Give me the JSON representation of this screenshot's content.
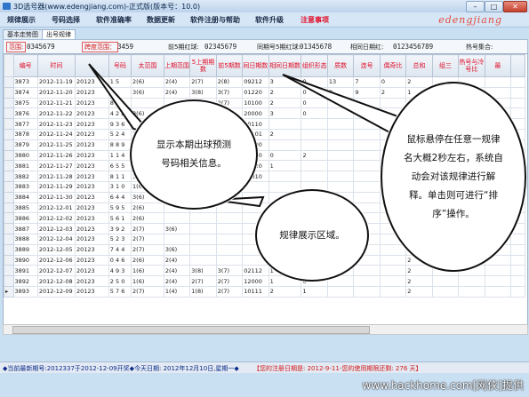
{
  "window": {
    "title": "3D选号器(www.edengjiang.com)-正式版(版本号：10.0)"
  },
  "menu": [
    "规律展示",
    "号码选择",
    "软件准确率",
    "数据更新",
    "软件注册与帮助",
    "软件升级",
    "注意事项"
  ],
  "menu_accent": "#e0102a",
  "logo": "edengjiang",
  "tabs": [
    "基本走势图",
    "出号规律"
  ],
  "infobar": {
    "range_label": "范围:",
    "range_value": "0345679",
    "span_label": "跨度范围：",
    "span_value": "3459",
    "prev5_label": "前5期红球:",
    "prev5_value": "02345679",
    "same5_label": "同期号5期红球:",
    "same5_value": "01345678",
    "adjacent_label": "相同日期红:",
    "adjacent_value": "0123456789",
    "hot_label": "热号集合:",
    "hot_value": ""
  },
  "table": {
    "headers": [
      "编号",
      "时间",
      "",
      "号码",
      "太范围",
      "上期范围",
      "5上期期数",
      "前5期数",
      "同日期数",
      "相同日期数",
      "组织形态",
      "质数",
      "连号",
      "偶奇比",
      "总和",
      "组三",
      "热号与冷号比",
      "最",
      ""
    ],
    "rows": [
      [
        "3873",
        "2012-11-19",
        "20123",
        "1 5",
        "2(6)",
        "2(4)",
        "2(7)",
        "2(8)",
        "09212",
        "3",
        "0",
        "13",
        "7",
        "0",
        "2"
      ],
      [
        "3874",
        "2012-11-20",
        "20123",
        "",
        "3(6)",
        "2(4)",
        "3(8)",
        "3(7)",
        "01220",
        "2",
        "0",
        "2",
        "9",
        "2",
        "1"
      ],
      [
        "3875",
        "2012-11-21",
        "20123",
        "8 5",
        "",
        "",
        "2(7)",
        "2(7)",
        "10100",
        "2",
        "0",
        "",
        "",
        "",
        "2"
      ],
      [
        "3876",
        "2012-11-22",
        "20123",
        "4 2 8",
        "3(6)",
        "",
        "3(8)",
        "3(7)",
        "20000",
        "3",
        "0",
        "",
        "",
        "",
        "2"
      ],
      [
        "3877",
        "2012-11-23",
        "20123",
        "9 3 6",
        "2(6)",
        "",
        "2(7)",
        "",
        "20110",
        "",
        "",
        "",
        "",
        "",
        "2"
      ],
      [
        "3878",
        "2012-11-24",
        "20123",
        "5 2 4",
        "2(6)",
        "",
        "2(8)",
        "",
        "02101",
        "2",
        "",
        "",
        "",
        "",
        "2"
      ],
      [
        "3879",
        "2012-11-25",
        "20123",
        "8 8 9",
        "2(6)",
        "",
        "2(7)",
        "",
        "01100",
        "",
        "",
        "",
        "",
        "",
        "2"
      ],
      [
        "3880",
        "2012-11-26",
        "20123",
        "1 1 4",
        "2(6)",
        "",
        "2(7)",
        "",
        "01220",
        "0",
        "2",
        "",
        "",
        "",
        "2"
      ],
      [
        "3881",
        "2012-11-27",
        "20123",
        "6 5 5",
        "2(6)",
        "",
        "2(8)",
        "",
        "00120",
        "1",
        "",
        "",
        "",
        "",
        "2"
      ],
      [
        "3882",
        "2012-11-28",
        "20123",
        "8 1 1",
        "3(6)",
        "",
        "",
        "",
        "01010",
        "",
        "",
        "",
        "",
        "",
        "2"
      ],
      [
        "3883",
        "2012-11-29",
        "20123",
        "3 1 0",
        "1(6)",
        "",
        "",
        "",
        "",
        "",
        "",
        "",
        "",
        "",
        "2"
      ],
      [
        "3884",
        "2012-11-30",
        "20123",
        "6 4 4",
        "3(6)",
        "",
        "",
        "",
        "",
        "",
        "",
        "",
        "",
        "",
        "2"
      ],
      [
        "3885",
        "2012-12-01",
        "20123",
        "5 9 5",
        "2(6)",
        "",
        "",
        "",
        "",
        "",
        "",
        "",
        "",
        "",
        "2"
      ],
      [
        "3886",
        "2012-12-02",
        "20123",
        "5 6 1",
        "2(6)",
        "",
        "",
        "",
        "",
        "",
        "",
        "",
        "",
        "",
        "2"
      ],
      [
        "3887",
        "2012-12-03",
        "20123",
        "3 9 2",
        "2(7)",
        "3(6)",
        "",
        "",
        "",
        "",
        "",
        "",
        "",
        "",
        "2"
      ],
      [
        "3888",
        "2012-12-04",
        "20123",
        "5 2 3",
        "2(7)",
        "",
        "",
        "",
        "",
        "",
        "",
        "",
        "",
        "",
        "2"
      ],
      [
        "3889",
        "2012-12-05",
        "20123",
        "7 4 4",
        "2(7)",
        "3(6)",
        "",
        "",
        "",
        "",
        "",
        "",
        "",
        "",
        "2"
      ],
      [
        "3890",
        "2012-12-06",
        "20123",
        "0 4 6",
        "2(6)",
        "2(4)",
        "",
        "",
        "",
        "",
        "",
        "",
        "",
        "",
        "2"
      ],
      [
        "3891",
        "2012-12-07",
        "20123",
        "4 9 3",
        "1(6)",
        "2(4)",
        "3(8)",
        "3(7)",
        "02112",
        "1",
        "0",
        "",
        "",
        "",
        "2"
      ],
      [
        "3892",
        "2012-12-08",
        "20123",
        "2 5 0",
        "1(6)",
        "2(4)",
        "2(7)",
        "2(7)",
        "12000",
        "1",
        "0",
        "",
        "",
        "",
        "2"
      ],
      [
        "3893",
        "2012-12-09",
        "20123",
        "5 7 6",
        "2(7)",
        "1(4)",
        "1(8)",
        "2(7)",
        "10111",
        "2",
        "1",
        "",
        "",
        "",
        "2"
      ]
    ]
  },
  "callouts": [
    "显示本期出球预测号码相关信息。",
    "规律展示区域。",
    "鼠标悬停在任意一规律名大概2秒左右，系统自动会对该规律进行解释。单击则可进行“排序”操作。"
  ],
  "status": {
    "latest": "◆当前最新期号:2012337于2012-12-09开奖◆今天日期: 2012年12月10日,星期一◆",
    "reg_warning": "【您的注册日期是: 2012-9-11-您的使用期限还剩: 276 天】"
  },
  "watermark": "www.hackhome.com[网侠]提供"
}
